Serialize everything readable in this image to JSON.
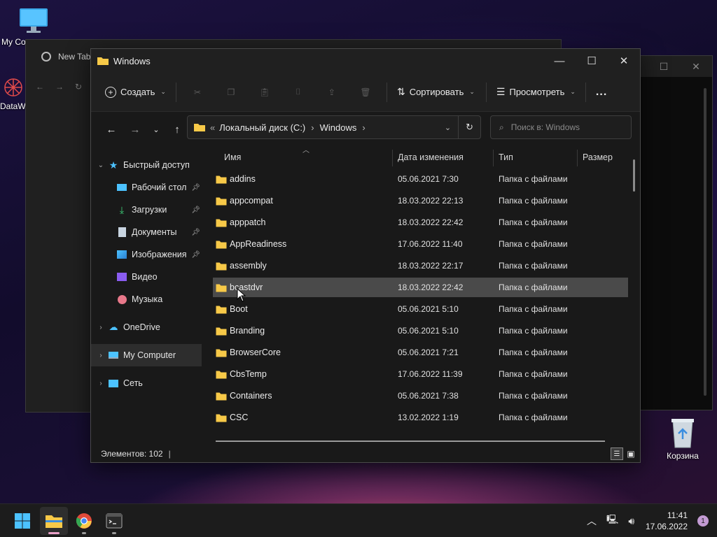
{
  "desktop": {
    "icons": [
      {
        "label": "My Computer",
        "icon": "monitor-icon"
      },
      {
        "label": "DataWorks",
        "icon": "dataworks-icon"
      },
      {
        "label": "Корзина",
        "icon": "recycle-bin-icon"
      }
    ]
  },
  "browser": {
    "tab_title": "New Tab"
  },
  "explorer": {
    "title": "Windows",
    "toolbar": {
      "create_label": "Создать",
      "sort_label": "Сортировать",
      "view_label": "Просмотреть",
      "more_label": "..."
    },
    "address": {
      "prefix": "«",
      "crumbs": [
        "Локальный диск (C:)",
        "Windows"
      ]
    },
    "search": {
      "placeholder": "Поиск в: Windows"
    },
    "nav": {
      "quick_access": "Быстрый доступ",
      "items": [
        {
          "label": "Рабочий стол",
          "icon": "desktop-icon",
          "pinned": true
        },
        {
          "label": "Загрузки",
          "icon": "download-icon",
          "pinned": true
        },
        {
          "label": "Документы",
          "icon": "document-icon",
          "pinned": true
        },
        {
          "label": "Изображения",
          "icon": "pictures-icon",
          "pinned": true
        },
        {
          "label": "Видео",
          "icon": "video-icon",
          "pinned": false
        },
        {
          "label": "Музыка",
          "icon": "music-icon",
          "pinned": false
        }
      ],
      "onedrive": "OneDrive",
      "my_computer": "My Computer",
      "network": "Сеть"
    },
    "columns": {
      "name": "Имя",
      "date": "Дата изменения",
      "type": "Тип",
      "size": "Размер"
    },
    "files": [
      {
        "name": "addins",
        "date": "05.06.2021 7:30",
        "type": "Папка с файлами"
      },
      {
        "name": "appcompat",
        "date": "18.03.2022 22:13",
        "type": "Папка с файлами"
      },
      {
        "name": "apppatch",
        "date": "18.03.2022 22:42",
        "type": "Папка с файлами"
      },
      {
        "name": "AppReadiness",
        "date": "17.06.2022 11:40",
        "type": "Папка с файлами"
      },
      {
        "name": "assembly",
        "date": "18.03.2022 22:17",
        "type": "Папка с файлами"
      },
      {
        "name": "bcastdvr",
        "date": "18.03.2022 22:42",
        "type": "Папка с файлами"
      },
      {
        "name": "Boot",
        "date": "05.06.2021 5:10",
        "type": "Папка с файлами"
      },
      {
        "name": "Branding",
        "date": "05.06.2021 5:10",
        "type": "Папка с файлами"
      },
      {
        "name": "BrowserCore",
        "date": "05.06.2021 7:21",
        "type": "Папка с файлами"
      },
      {
        "name": "CbsTemp",
        "date": "17.06.2022 11:39",
        "type": "Папка с файлами"
      },
      {
        "name": "Containers",
        "date": "05.06.2021 7:38",
        "type": "Папка с файлами"
      },
      {
        "name": "CSC",
        "date": "13.02.2022 1:19",
        "type": "Папка с файлами"
      }
    ],
    "status": {
      "count_label": "Элементов: 102",
      "separator": "|"
    }
  },
  "taskbar": {
    "time": "11:41",
    "date": "17.06.2022",
    "notifications": "1"
  },
  "colors": {
    "folder": "#f7c948",
    "accent": "#4cc2ff",
    "hover_row": "#4a4a4a"
  }
}
